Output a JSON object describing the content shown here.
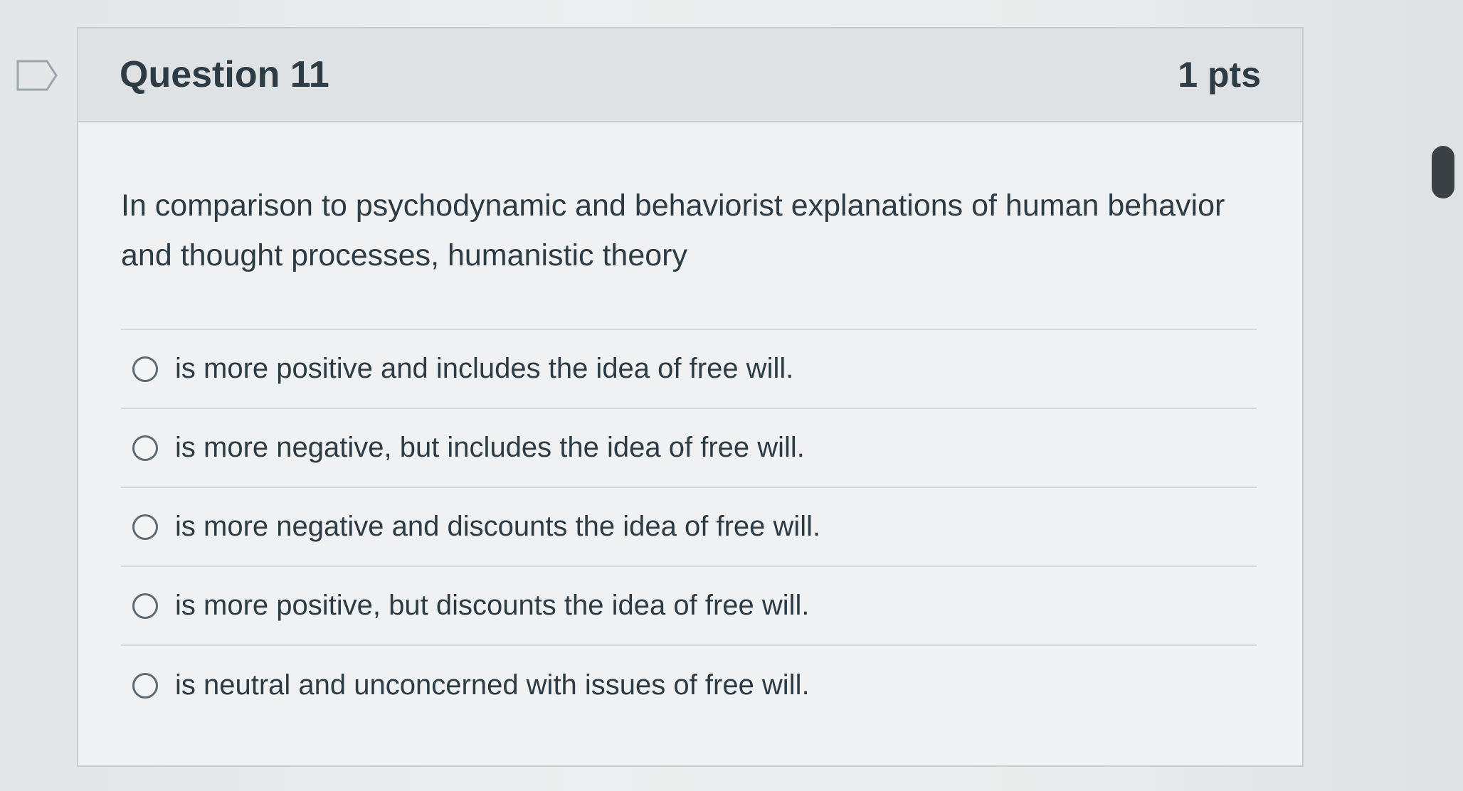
{
  "question": {
    "title": "Question 11",
    "points": "1 pts",
    "text": "In comparison to psychodynamic and behaviorist explanations of human behavior and thought processes, humanistic theory",
    "answers": [
      {
        "label": "is more positive and includes the idea of free will."
      },
      {
        "label": "is more negative, but includes the idea of free will."
      },
      {
        "label": "is more negative and discounts the idea of free will."
      },
      {
        "label": "is more positive, but discounts the idea of free will."
      },
      {
        "label": "is neutral and unconcerned with issues of free will."
      }
    ]
  },
  "icons": {
    "flag": "flag-question-icon",
    "radio": "radio-button-icon"
  },
  "colors": {
    "text": "#2d3b45",
    "header_bg": "#dfe2e4",
    "border": "#c7cdd1"
  }
}
